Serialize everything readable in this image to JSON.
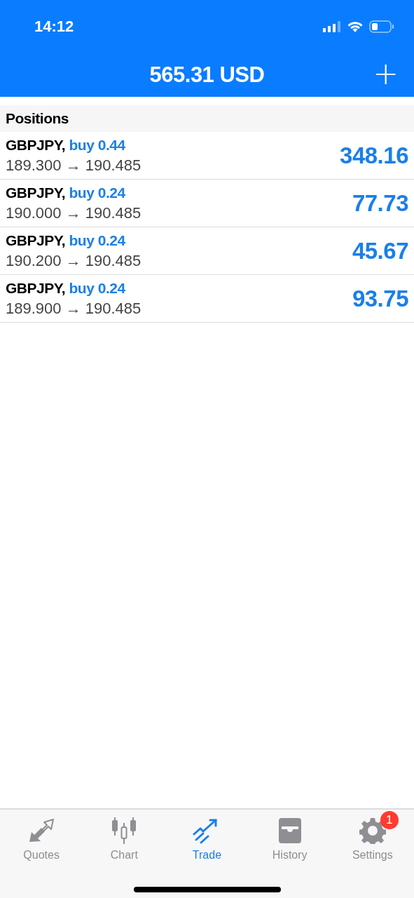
{
  "status_bar": {
    "time": "14:12"
  },
  "header": {
    "title": "565.31 USD",
    "add_icon": "+"
  },
  "section": {
    "title": "Positions"
  },
  "positions": [
    {
      "symbol": "GBPJPY,",
      "side": "buy 0.44",
      "prices": "189.300 → 190.485",
      "profit": "348.16"
    },
    {
      "symbol": "GBPJPY,",
      "side": "buy 0.24",
      "prices": "190.000 → 190.485",
      "profit": "77.73"
    },
    {
      "symbol": "GBPJPY,",
      "side": "buy 0.24",
      "prices": "190.200 → 190.485",
      "profit": "45.67"
    },
    {
      "symbol": "GBPJPY,",
      "side": "buy 0.24",
      "prices": "189.900 → 190.485",
      "profit": "93.75"
    }
  ],
  "tabs": [
    {
      "kind": "quotes",
      "label": "Quotes",
      "selected": false
    },
    {
      "kind": "chart",
      "label": "Chart",
      "selected": false
    },
    {
      "kind": "trade",
      "label": "Trade",
      "selected": true
    },
    {
      "kind": "history",
      "label": "History",
      "selected": false
    },
    {
      "kind": "settings",
      "label": "Settings",
      "selected": false,
      "badge": "1"
    }
  ]
}
